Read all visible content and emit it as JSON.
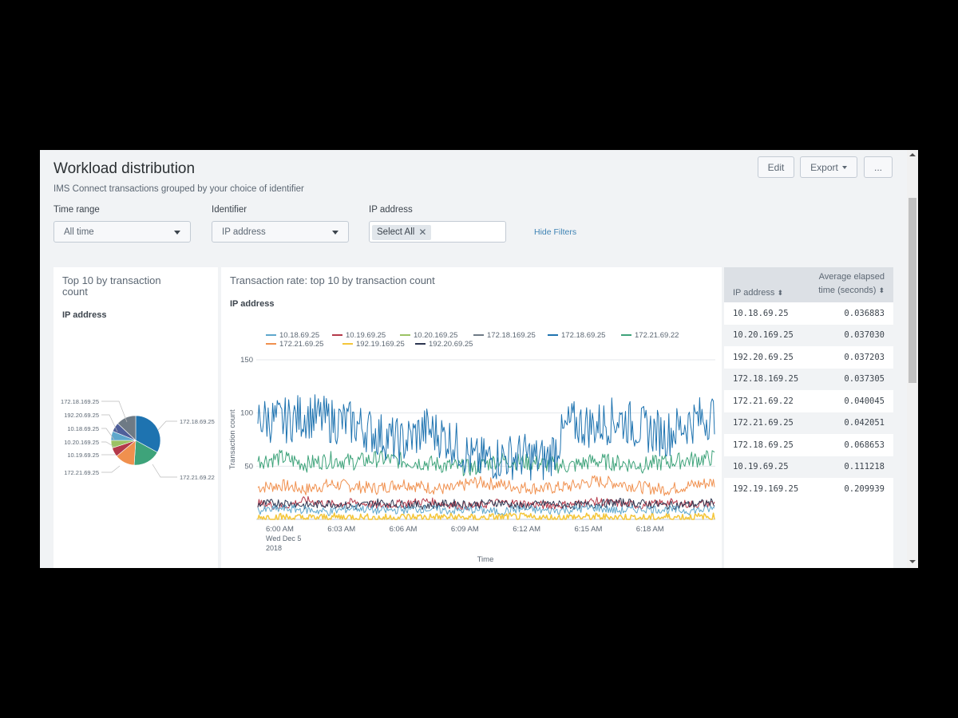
{
  "header": {
    "title": "Workload distribution",
    "subtitle": "IMS Connect transactions grouped by your choice of identifier",
    "edit_label": "Edit",
    "export_label": "Export",
    "more_label": "..."
  },
  "filters": {
    "time_range": {
      "label": "Time range",
      "value": "All time"
    },
    "identifier": {
      "label": "Identifier",
      "value": "IP address"
    },
    "ip_address": {
      "label": "IP address",
      "token": "Select All"
    },
    "hide_filters": "Hide Filters"
  },
  "pie_panel": {
    "title": "Top 10 by transaction count",
    "subtitle": "IP address"
  },
  "line_panel": {
    "title": "Transaction rate: top 10 by transaction count",
    "subtitle": "IP address"
  },
  "table": {
    "columns": [
      "IP address",
      "Average elapsed time (seconds)"
    ],
    "col1": "IP address",
    "col2a": "Average elapsed",
    "col2b": "time (seconds)",
    "rows": [
      {
        "ip": "10.18.69.25",
        "time": "0.036883"
      },
      {
        "ip": "10.20.169.25",
        "time": "0.037030"
      },
      {
        "ip": "192.20.69.25",
        "time": "0.037203"
      },
      {
        "ip": "172.18.169.25",
        "time": "0.037305"
      },
      {
        "ip": "172.21.69.22",
        "time": "0.040045"
      },
      {
        "ip": "172.21.69.25",
        "time": "0.042051"
      },
      {
        "ip": "172.18.69.25",
        "time": "0.068653"
      },
      {
        "ip": "10.19.69.25",
        "time": "0.111218"
      },
      {
        "ip": "192.19.169.25",
        "time": "0.209939"
      }
    ]
  },
  "chart_data": [
    {
      "type": "pie",
      "title": "Top 10 by transaction count",
      "subtitle": "IP address",
      "slices": [
        {
          "label": "172.18.69.25",
          "value": 33,
          "color": "#1e73b0"
        },
        {
          "label": "172.21.69.22",
          "value": 18,
          "color": "#3ea37a"
        },
        {
          "label": "172.21.69.25",
          "value": 13,
          "color": "#f0904e"
        },
        {
          "label": "10.19.69.25",
          "value": 6,
          "color": "#b4394a"
        },
        {
          "label": "10.20.169.25",
          "value": 5,
          "color": "#9bc264"
        },
        {
          "label": "10.18.69.25",
          "value": 6,
          "color": "#5ea7cc"
        },
        {
          "label": "192.20.69.25",
          "value": 6,
          "color": "#4f5f9a"
        },
        {
          "label": "172.18.169.25",
          "value": 13,
          "color": "#6e7a85"
        }
      ]
    },
    {
      "type": "line",
      "title": "Transaction rate: top 10 by transaction count",
      "subtitle": "IP address",
      "xlabel": "Time",
      "ylabel": "Transaction count",
      "ylim": [
        0,
        150
      ],
      "yticks": [
        50,
        100,
        150
      ],
      "xticks": [
        "6:00 AM",
        "6:03 AM",
        "6:06 AM",
        "6:09 AM",
        "6:12 AM",
        "6:15 AM",
        "6:18 AM"
      ],
      "xtick_date": [
        "Wed Dec 5",
        "2018"
      ],
      "legend_rows": [
        [
          "10.18.69.25",
          "10.19.69.25",
          "10.20.169.25",
          "172.18.169.25",
          "172.18.69.25",
          "172.21.69.22"
        ],
        [
          "172.21.69.25",
          "192.19.169.25",
          "192.20.69.25"
        ]
      ],
      "series": [
        {
          "name": "172.21.69.25",
          "color": "#f0904e",
          "values": [
            30,
            32,
            28,
            33,
            31,
            29,
            34,
            30,
            28,
            35,
            33,
            30,
            29,
            31,
            36,
            34,
            30,
            28,
            32,
            35
          ]
        },
        {
          "name": "172.21.69.22",
          "color": "#3ea37a",
          "values": [
            55,
            58,
            52,
            56,
            54,
            57,
            55,
            53,
            50,
            48,
            56,
            54,
            52,
            50,
            55,
            53,
            51,
            54,
            56,
            58
          ]
        },
        {
          "name": "172.18.69.25",
          "color": "#1e73b0",
          "values": [
            95,
            92,
            98,
            93,
            90,
            80,
            72,
            85,
            75,
            55,
            58,
            60,
            55,
            90,
            88,
            95,
            85,
            80,
            92,
            98
          ]
        },
        {
          "name": "10.19.69.25",
          "color": "#b4394a",
          "values": [
            15,
            12,
            18,
            14,
            16,
            13,
            15,
            17,
            14,
            12,
            16,
            15,
            13,
            14,
            17,
            15,
            13,
            16,
            14,
            15
          ]
        },
        {
          "name": "192.20.69.25",
          "color": "#2d3651",
          "values": [
            14,
            16,
            13,
            15,
            12,
            16,
            14,
            13,
            15,
            14,
            16,
            12,
            15,
            13,
            14,
            16,
            15,
            13,
            14,
            16
          ]
        },
        {
          "name": "10.18.69.25",
          "color": "#5ea7cc",
          "values": [
            8,
            10,
            9,
            7,
            11,
            8,
            9,
            10,
            8,
            9,
            7,
            10,
            8,
            9,
            11,
            8,
            10,
            9,
            8,
            10
          ]
        },
        {
          "name": "192.19.169.25",
          "color": "#f4c63a",
          "values": [
            2,
            2,
            1,
            2,
            2,
            1,
            2,
            2,
            2,
            1,
            2,
            2,
            1,
            2,
            2,
            2,
            1,
            2,
            2,
            2
          ]
        }
      ]
    }
  ]
}
